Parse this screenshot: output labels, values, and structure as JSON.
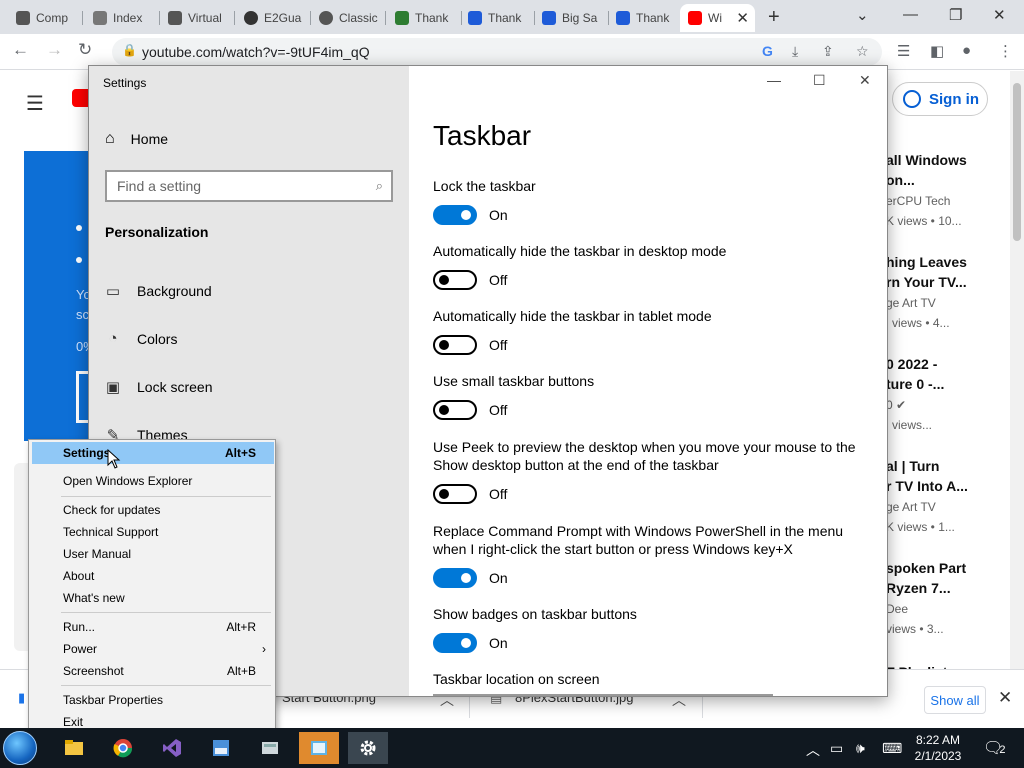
{
  "browser": {
    "tabs": [
      {
        "label": "Comp",
        "favicon": "#555555"
      },
      {
        "label": "Index",
        "favicon": "#777777"
      },
      {
        "label": "Virtual",
        "favicon": "#555555"
      },
      {
        "label": "E2Gua",
        "favicon": "#333333"
      },
      {
        "label": "Classic",
        "favicon": "#555555"
      },
      {
        "label": "Thank",
        "favicon": "#2e7d32"
      },
      {
        "label": "Thank",
        "favicon": "#1e5bd8"
      },
      {
        "label": "Big Sa",
        "favicon": "#1e5bd8"
      },
      {
        "label": "Thank",
        "favicon": "#1e5bd8"
      },
      {
        "label": "Wi",
        "favicon": "#ff0000"
      }
    ],
    "url": "youtube.com/watch?v=-9tUF4im_qQ"
  },
  "youtube": {
    "sign_in": "Sign in",
    "left_panel_texts": [
      "Yo",
      "sc",
      "0%"
    ],
    "recommendations": [
      {
        "title1": "all Windows",
        "title2": "on...",
        "channel": "erCPU Tech",
        "meta": "K views  • 10..."
      },
      {
        "title1": "hing Leaves",
        "title2": "rn Your TV...",
        "channel": "ge Art TV",
        "meta": "l views  • 4..."
      },
      {
        "title1": "0 2022 -",
        "title2": "ture 0 -...",
        "channel": "0",
        "meta": "l views..."
      },
      {
        "title1": "al | Turn",
        "title2": "r TV Into A...",
        "channel": "ge Art TV",
        "meta": "K views  • 1..."
      },
      {
        "title1": "spoken Part",
        "title2": "Ryzen 7...",
        "channel": "Dee",
        "meta": "views  • 3..."
      },
      {
        "title1": "T Playlist",
        "title2": "",
        "channel": "",
        "meta": ""
      }
    ]
  },
  "downloads": {
    "item1": "Start Button.png",
    "item2": "8PlexStartButton.jpg",
    "show_all": "Show all"
  },
  "settings": {
    "window_title": "Settings",
    "home": "Home",
    "search_placeholder": "Find a setting",
    "section": "Personalization",
    "nav": [
      {
        "label": "Background",
        "icon": "image-icon"
      },
      {
        "label": "Colors",
        "icon": "palette-icon"
      },
      {
        "label": "Lock screen",
        "icon": "lock-screen-icon"
      },
      {
        "label": "Themes",
        "icon": "themes-icon"
      }
    ],
    "page_title": "Taskbar",
    "options": [
      {
        "label": "Lock the taskbar",
        "state": "On"
      },
      {
        "label": "Automatically hide the taskbar in desktop mode",
        "state": "Off"
      },
      {
        "label": "Automatically hide the taskbar in tablet mode",
        "state": "Off"
      },
      {
        "label": "Use small taskbar buttons",
        "state": "Off"
      },
      {
        "label": "Use Peek to preview the desktop when you move your mouse to the Show desktop button at the end of the taskbar",
        "state": "Off"
      },
      {
        "label": "Replace Command Prompt with Windows PowerShell in the menu when I right-click the start button or press Windows key+X",
        "state": "On"
      },
      {
        "label": "Show badges on taskbar buttons",
        "state": "On"
      }
    ],
    "location_label": "Taskbar location on screen"
  },
  "context_menu": {
    "items": [
      {
        "label": "Settings",
        "accel": "Alt+S"
      },
      {
        "label": "Open Windows Explorer",
        "accel": ""
      },
      {
        "label": "Check for updates",
        "accel": ""
      },
      {
        "label": "Technical Support",
        "accel": ""
      },
      {
        "label": "User Manual",
        "accel": ""
      },
      {
        "label": "About",
        "accel": ""
      },
      {
        "label": "What's new",
        "accel": ""
      },
      {
        "label": "Run...",
        "accel": "Alt+R"
      },
      {
        "label": "Power",
        "accel": "›"
      },
      {
        "label": "Screenshot",
        "accel": "Alt+B"
      },
      {
        "label": "Taskbar Properties",
        "accel": ""
      },
      {
        "label": "Exit",
        "accel": ""
      }
    ]
  },
  "taskbar": {
    "time": "8:22 AM",
    "date": "2/1/2023",
    "notifications": "2",
    "accent": "#0078d7"
  }
}
